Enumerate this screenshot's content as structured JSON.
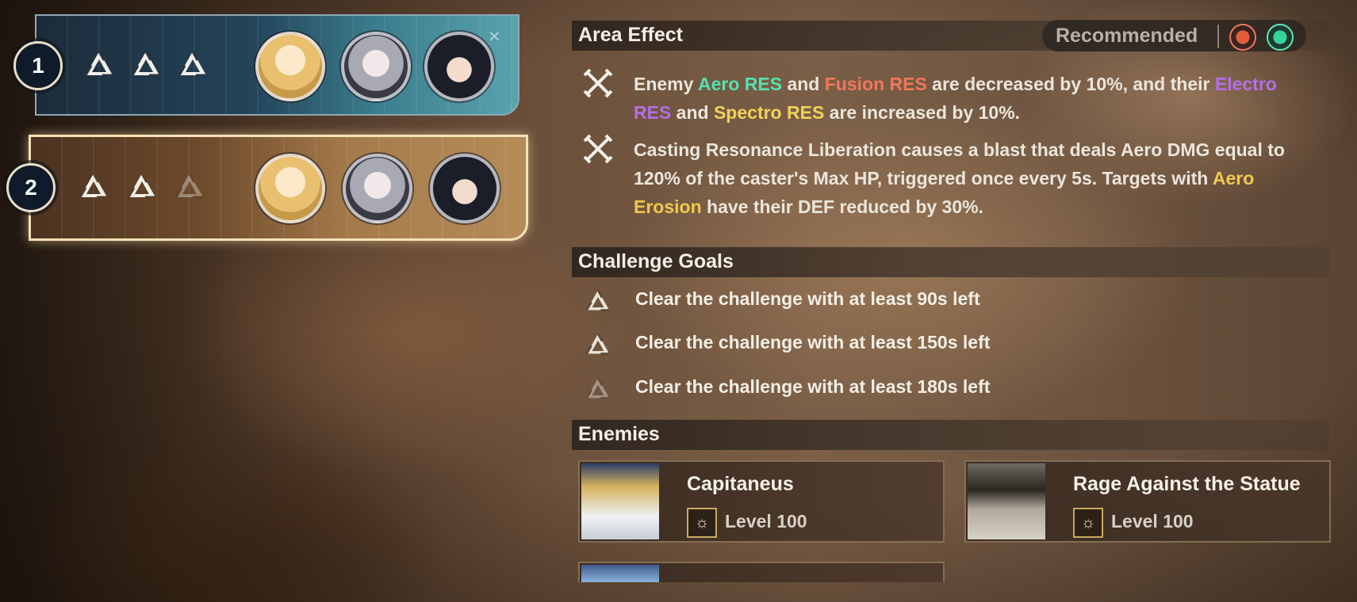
{
  "stages": [
    {
      "number": "1",
      "goals_achieved": 3,
      "goals_total": 3,
      "team": [
        "character-1-avatar",
        "character-2-avatar",
        "character-3-avatar"
      ],
      "selected": false
    },
    {
      "number": "2",
      "goals_achieved": 2,
      "goals_total": 3,
      "team": [
        "character-1-avatar",
        "character-2-avatar",
        "character-3-avatar"
      ],
      "selected": true
    }
  ],
  "area_effect": {
    "title": "Area Effect",
    "recommended_label": "Recommended",
    "recommended_icons": [
      "fusion-element-icon",
      "aero-element-icon"
    ],
    "effects": [
      {
        "icon": "crossed-swords-icon",
        "parts": [
          {
            "text": "Enemy ",
            "style": "normal"
          },
          {
            "text": "Aero RES",
            "style": "aero"
          },
          {
            "text": " and ",
            "style": "normal"
          },
          {
            "text": "Fusion RES",
            "style": "fusion"
          },
          {
            "text": " are decreased by 10%, and their ",
            "style": "normal"
          },
          {
            "text": "Electro RES",
            "style": "electro"
          },
          {
            "text": " and ",
            "style": "normal"
          },
          {
            "text": "Spectro RES",
            "style": "spectro"
          },
          {
            "text": " are increased by 10%.",
            "style": "normal"
          }
        ]
      },
      {
        "icon": "crossed-swords-icon",
        "parts": [
          {
            "text": "Casting Resonance Liberation causes a blast that deals Aero DMG equal to 120% of the caster's Max HP, triggered once every 5s. Targets with ",
            "style": "normal"
          },
          {
            "text": "Aero Erosion",
            "style": "erosion"
          },
          {
            "text": " have their DEF reduced by 30%.",
            "style": "normal"
          }
        ]
      }
    ]
  },
  "challenge_goals": {
    "title": "Challenge Goals",
    "goals": [
      {
        "text": "Clear the challenge with at least 90s left",
        "achieved": true
      },
      {
        "text": "Clear the challenge with at least 150s left",
        "achieved": true
      },
      {
        "text": "Clear the challenge with at least 180s left",
        "achieved": false
      }
    ]
  },
  "enemies": {
    "title": "Enemies",
    "list": [
      {
        "name": "Capitaneus",
        "level": "Level 100"
      },
      {
        "name": "Rage Against the Statue",
        "level": "Level 100"
      }
    ]
  },
  "colors": {
    "aero": "#57e0b0",
    "fusion": "#f0785b",
    "electro": "#b56ee8",
    "spectro": "#efd35a",
    "erosion": "#f2c84f"
  }
}
